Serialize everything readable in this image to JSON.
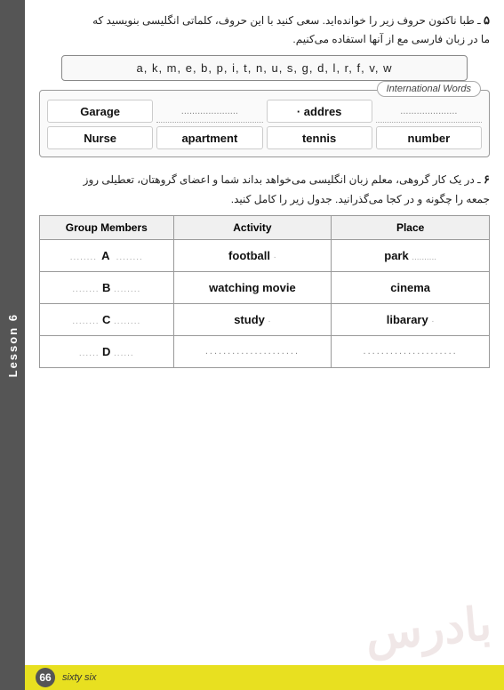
{
  "lesson": {
    "tab_label": "Lesson 6"
  },
  "section5": {
    "number": "۵",
    "text_line1": "ـ طبا ناکنون حروف زیر را خوانده‌اید. سعی کنید با این حروف، کلماتی انگلیسی بنویسید که",
    "text_line2": "ما در زبان فارسی مع از آنها استفاده می‌کنیم.",
    "letters": "a, k, m, e, b, p, i, t, n, u, s, g, d, l, r, f, v, w",
    "intl_words_label": "International Words",
    "words": [
      {
        "text": "Garage",
        "type": "bold"
      },
      {
        "text": "...................",
        "type": "dotted"
      },
      {
        "text": "addres",
        "type": "bold"
      },
      {
        "text": "...................",
        "type": "dotted"
      },
      {
        "text": "Nurse",
        "type": "bold"
      },
      {
        "text": "apartment",
        "type": "bold"
      },
      {
        "text": "tennis",
        "type": "bold"
      },
      {
        "text": "number",
        "type": "bold"
      }
    ]
  },
  "section6": {
    "number": "۶",
    "text_line1": "ـ در یک کار گروهی، معلم زبان انگلیسی می‌خواهد بداند شما و اعضای گروهتان، تعطیلی روز",
    "text_line2": "جمعه را چگونه و در کجا می‌گذرانید. جدول زیر را کامل کنید.",
    "table": {
      "headers": [
        "Group Members",
        "Activity",
        "Place"
      ],
      "rows": [
        {
          "group": "A",
          "group_style": "bold",
          "activity": "football",
          "activity_style": "bold",
          "place": "park",
          "place_style": "bold"
        },
        {
          "group": "B",
          "group_style": "bold",
          "activity": "watching movie",
          "activity_style": "bold",
          "place": "cinema",
          "place_style": "bold"
        },
        {
          "group": "C",
          "group_style": "bold",
          "activity": "study",
          "activity_style": "bold",
          "place": "libarary",
          "place_style": "bold"
        },
        {
          "group": "D",
          "group_style": "bold",
          "activity": "...................",
          "activity_style": "dotted",
          "place": "...................",
          "place_style": "dotted"
        }
      ]
    }
  },
  "footer": {
    "page_number": "66",
    "page_text": "sixty six"
  }
}
